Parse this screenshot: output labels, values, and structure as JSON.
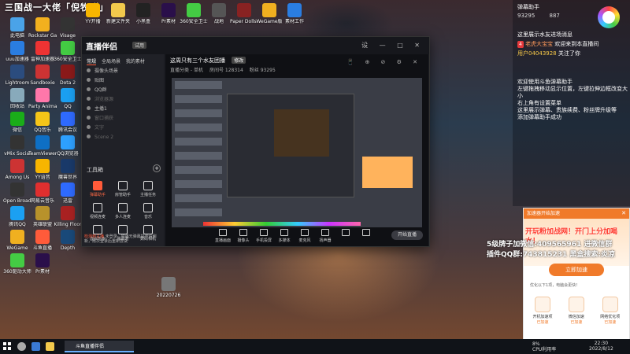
{
  "desktop": {
    "top_title": "三国战一大佬「倪牧群」",
    "icons": [
      {
        "label": "此电脑",
        "color": "#4aa3e8"
      },
      {
        "label": "Rockstar Games",
        "color": "#f2b01e"
      },
      {
        "label": "Visage",
        "color": "#333"
      },
      {
        "label": "uuu加速器",
        "color": "#2a7de1"
      },
      {
        "label": "雷神加速器",
        "color": "#e33"
      },
      {
        "label": "360安全卫士",
        "color": "#4c4"
      },
      {
        "label": "Lightroom",
        "color": "#2b4c7e"
      },
      {
        "label": "Sandboxie",
        "color": "#c33"
      },
      {
        "label": "Dota 2",
        "color": "#8b1a1a"
      },
      {
        "label": "回收站",
        "color": "#8ab"
      },
      {
        "label": "Party Animals",
        "color": "#f7a"
      },
      {
        "label": "QQ",
        "color": "#1ba0f2"
      },
      {
        "label": "微信",
        "color": "#1aad19"
      },
      {
        "label": "QQ音乐",
        "color": "#f5c518"
      },
      {
        "label": "腾讯会议",
        "color": "#2f6bff"
      },
      {
        "label": "vMix Social",
        "color": "#333"
      },
      {
        "label": "TeamViewer",
        "color": "#0e6fc4"
      },
      {
        "label": "QQ浏览器",
        "color": "#2ea1ff"
      },
      {
        "label": "Among Us",
        "color": "#c33"
      },
      {
        "label": "YY语音",
        "color": "#f7b500"
      },
      {
        "label": "魔兽世界",
        "color": "#1a3a6a"
      },
      {
        "label": "Open Broadcaster",
        "color": "#333"
      },
      {
        "label": "网易云音乐",
        "color": "#e02f2f"
      },
      {
        "label": "迅雷",
        "color": "#2f6bff"
      },
      {
        "label": "腾讯QQ",
        "color": "#1ba0f2"
      },
      {
        "label": "英雄联盟",
        "color": "#b8922b"
      },
      {
        "label": "Killing Floor",
        "color": "#a22"
      },
      {
        "label": "WeGame",
        "color": "#f0b020"
      },
      {
        "label": "斗鱼直播",
        "color": "#ff5b3a"
      },
      {
        "label": "Depth",
        "color": "#1a4a7a"
      },
      {
        "label": "360驱动大师",
        "color": "#4c4"
      },
      {
        "label": "Pr素材",
        "color": "#2a0f4a"
      },
      {
        "label": "YY开播",
        "color": "#f7b500"
      },
      {
        "label": "新建文件夹",
        "color": "#f2c94c"
      },
      {
        "label": "小黑盒",
        "color": "#222"
      },
      {
        "label": "Pr素材",
        "color": "#2a0f4a"
      },
      {
        "label": "360安全卫士",
        "color": "#4c4"
      },
      {
        "label": "战地",
        "color": "#555"
      },
      {
        "label": "Paper Dolls Original",
        "color": "#822"
      },
      {
        "label": "WeGame版",
        "color": "#f0b020"
      },
      {
        "label": "素材工作",
        "color": "#2a7de1"
      },
      {
        "label": "20220726",
        "color": "#777"
      }
    ]
  },
  "chat": {
    "room_name": "弹幕助手",
    "heat": "93295",
    "online": "887",
    "messages": [
      {
        "text": "这里展示水友进场消息"
      },
      {
        "badge": "4",
        "user": "老虎大宝宝",
        "text": "欢迎来到本直播间"
      },
      {
        "user": "用户04043928",
        "text": "关注了你"
      }
    ],
    "helper_lines": [
      "欢迎使用斗鱼弹幕助手",
      "左键拖拽移动显示位置，左键拉伸边框改变大小",
      "右上角有设置菜单",
      "这里展示弹幕、贵族续费、粉丝牌升级等",
      "添加弹幕助手成功"
    ]
  },
  "app": {
    "logo": "直播伴侣",
    "logo_tag": "试用",
    "win_controls": "设 — □ ✕",
    "left_tabs": [
      "常规",
      "全局场景",
      "我的素材"
    ],
    "scenes": [
      {
        "label": "摄像头场景",
        "dim": false
      },
      {
        "label": "贴图",
        "dim": false
      },
      {
        "label": "QQ群",
        "dim": false
      },
      {
        "label": "浏览器源",
        "dim": true
      },
      {
        "label": "主播1",
        "dim": false
      },
      {
        "label": "窗口捕获",
        "dim": true
      },
      {
        "label": "文字",
        "dim": true
      },
      {
        "label": "Scene 2",
        "dim": true
      }
    ],
    "tools_title": "工具箱",
    "tools": [
      {
        "label": "弹幕助手",
        "icon": "chat-icon",
        "hl": true
      },
      {
        "label": "房管助手",
        "icon": "user-icon",
        "hl": false
      },
      {
        "label": "主播任务",
        "icon": "task-icon",
        "hl": false
      },
      {
        "label": "视频连麦",
        "icon": "video-icon",
        "hl": false
      },
      {
        "label": "多人连麦",
        "icon": "mic-icon",
        "hl": false
      },
      {
        "label": "音乐",
        "icon": "music-icon",
        "hl": false
      },
      {
        "label": "虚拟形象",
        "icon": "avatar-icon",
        "hl": false
      },
      {
        "label": "弹幕君",
        "icon": "bot-icon",
        "hl": false
      },
      {
        "label": "数码相机",
        "icon": "camera-icon",
        "hl": false
      }
    ],
    "notice_warn": "检测到主播",
    "notice": "未登录，如遇无弹幕提示请刷新，再次登录后重新尝试",
    "room_title": "这周只有三个水友团播",
    "room_edit": "修改",
    "room_meta": [
      "直播分类 - 单机",
      "房间号 128314",
      "粉丝 93295"
    ],
    "stage_icons": "📱 ⊕ ⊘ ⚙ ✕",
    "bottom_tools": [
      "直播画面",
      "摄像头",
      "手机投屏",
      "多媒体",
      "麦克风",
      "扬声器",
      "",
      ""
    ],
    "start_live": "开始直播"
  },
  "promo": {
    "title": "开玩粉加战网！开门上分加喝水！",
    "line1": "5级牌子加微信:409565961 进微信群",
    "line2": "插件QQ群:743815231 黑盒搜索:炎凉",
    "popup_header": "加速器开始加速",
    "popup_close": "✕",
    "accel_button": "立即加速",
    "optimize_text": "优化以下1项，电脑会更快！",
    "apps": [
      {
        "label": "开机加速项",
        "action": "已加速"
      },
      {
        "label": "微信加速",
        "action": "已加速"
      },
      {
        "label": "网络优化项",
        "action": "已加速"
      }
    ]
  },
  "taskbar": {
    "app_label": "斗鱼直播伴侣",
    "tray_cpu": "8%",
    "tray_cpu_label": "CPU利用率",
    "time": "22:30",
    "date": "2022/8/12"
  }
}
